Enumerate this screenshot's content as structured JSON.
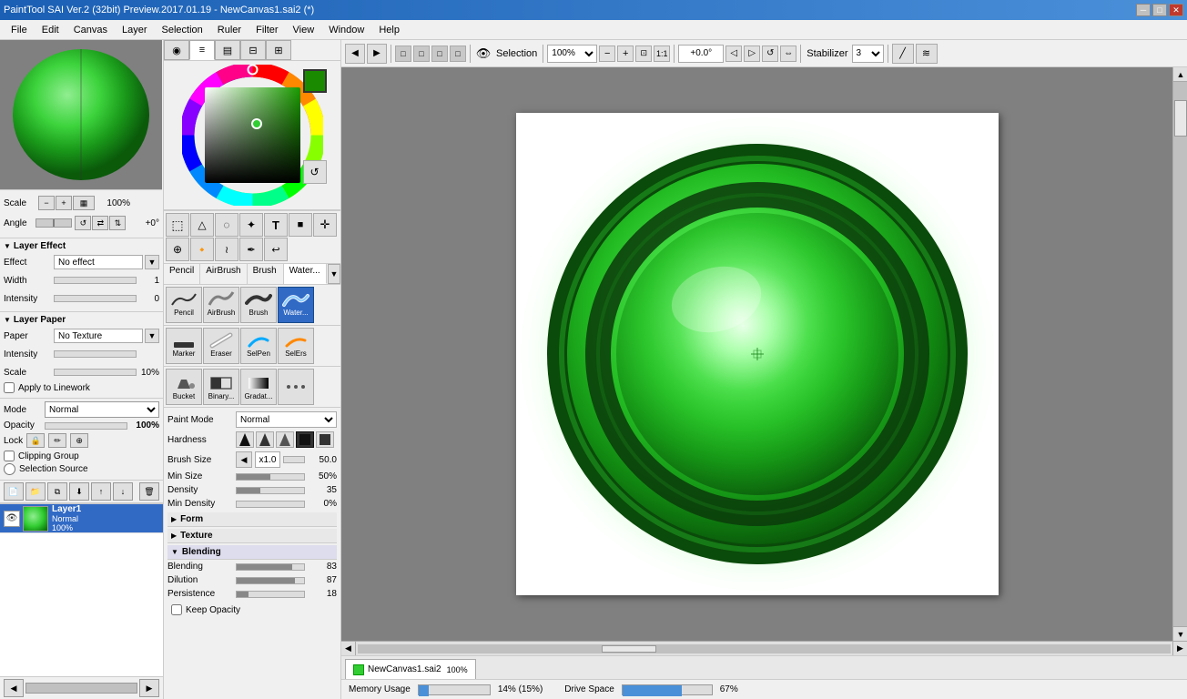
{
  "window": {
    "title": "PaintTool SAI Ver.2 (32bit) Preview.2017.01.19 - NewCanvas1.sai2 (*)",
    "controls": [
      "─",
      "□",
      "✕"
    ]
  },
  "menu": {
    "items": [
      "File",
      "Edit",
      "Canvas",
      "Layer",
      "Selection",
      "Ruler",
      "Filter",
      "View",
      "Window",
      "Help"
    ]
  },
  "toolbar": {
    "nav_btns": [
      "←",
      "→"
    ],
    "opacity_btns": [
      "□",
      "□",
      "□",
      "□"
    ],
    "selection_label": "Selection",
    "zoom_value": "100%",
    "zoom_minus": "−",
    "zoom_plus": "+",
    "zoom_fit": "⊡",
    "zoom_100": "1:1",
    "angle_value": "+0.0°",
    "angle_dec": "◁",
    "angle_inc": "▷",
    "angle_reset": "↺",
    "mirror": "⇔",
    "stabilizer_label": "Stabilizer",
    "stabilizer_value": "3",
    "tool1": "╱",
    "tool2": "≋"
  },
  "left_panel": {
    "scale_label": "Scale",
    "scale_value": "100%",
    "angle_label": "Angle",
    "angle_value": "+0°",
    "layer_effect_title": "Layer Effect",
    "effect_label": "Effect",
    "effect_value": "No effect",
    "width_label": "Width",
    "width_value": "",
    "intensity_label": "Intensity",
    "intensity_value": "0",
    "layer_paper_title": "Layer Paper",
    "paper_label": "Paper",
    "paper_value": "No Texture",
    "paper_intensity_label": "Intensity",
    "paper_scale_label": "Scale",
    "paper_scale_value": "10%",
    "apply_linework_label": "Apply to Linework",
    "mode_label": "Mode",
    "mode_value": "Normal",
    "opacity_label": "Opacity",
    "opacity_value": "100%",
    "lock_label": "Lock",
    "clipping_group_label": "Clipping Group",
    "selection_source_label": "Selection Source"
  },
  "layer_toolbar": {
    "buttons": [
      "new_layer",
      "new_group",
      "delete",
      "merge_down",
      "duplicate",
      "move_up",
      "move_down",
      "new_lset"
    ]
  },
  "layers": [
    {
      "name": "Layer1",
      "mode": "Normal",
      "opacity": "100%",
      "visible": true,
      "active": true
    }
  ],
  "color": {
    "mode_tabs": [
      {
        "id": "wheel",
        "icon": "◉"
      },
      {
        "id": "hsv",
        "icon": "≡"
      },
      {
        "id": "rgb",
        "icon": "⊞"
      },
      {
        "id": "cmyk",
        "icon": "⊟"
      },
      {
        "id": "other",
        "icon": "⊠"
      }
    ],
    "current": "#1a8a00"
  },
  "selection_tools": [
    {
      "id": "rect_sel",
      "icon": "⬚",
      "label": ""
    },
    {
      "id": "poly_sel",
      "icon": "△",
      "label": ""
    },
    {
      "id": "lasso_sel",
      "icon": "◌",
      "label": ""
    },
    {
      "id": "wand_sel",
      "icon": "✦",
      "label": ""
    },
    {
      "id": "text",
      "icon": "T",
      "label": ""
    },
    {
      "id": "fill_col",
      "icon": "■",
      "label": ""
    },
    {
      "id": "move",
      "icon": "✛",
      "label": ""
    },
    {
      "id": "zoom",
      "icon": "⊕",
      "label": ""
    },
    {
      "id": "eyedrop",
      "icon": "♦",
      "label": ""
    },
    {
      "id": "smear",
      "icon": "≀",
      "label": ""
    },
    {
      "id": "pen",
      "icon": "✒",
      "label": ""
    },
    {
      "id": "undo_sel",
      "icon": "↩",
      "label": ""
    }
  ],
  "brush_tabs": [
    {
      "label": "Pencil",
      "active": false
    },
    {
      "label": "AirBrush",
      "active": false
    },
    {
      "label": "Brush",
      "active": false
    },
    {
      "label": "Water...",
      "active": true
    }
  ],
  "brush_tools": [
    {
      "label": "Marker",
      "icon": "marker"
    },
    {
      "label": "Eraser",
      "icon": "eraser"
    },
    {
      "label": "SelPen",
      "icon": "selpen"
    },
    {
      "label": "SelErs",
      "icon": "selers"
    }
  ],
  "extra_tools": [
    {
      "label": "Bucket",
      "icon": "bucket"
    },
    {
      "label": "Binary...",
      "icon": "binary"
    },
    {
      "label": "Gradat...",
      "icon": "gradient"
    }
  ],
  "brush_params": {
    "paint_mode_label": "Paint Mode",
    "paint_mode_value": "Normal",
    "hardness_label": "Hardness",
    "brush_size_label": "Brush Size",
    "brush_size_mult": "x1.0",
    "brush_size_value": "50.0",
    "min_size_label": "Min Size",
    "min_size_value": "50%",
    "density_label": "Density",
    "density_value": "35",
    "min_density_label": "Min Density",
    "min_density_value": "0%",
    "form_label": "Form",
    "texture_label": "Texture",
    "blending_label": "Blending",
    "blending_sublabel": "Blending",
    "blending_value": "83",
    "dilution_label": "Dilution",
    "dilution_value": "87",
    "persistence_label": "Persistence",
    "persistence_value": "18",
    "keep_opacity_label": "Keep Opacity"
  },
  "canvas": {
    "tab_name": "NewCanvas1.sai2",
    "tab_zoom": "100%"
  },
  "statusbar": {
    "memory_label": "Memory Usage",
    "memory_value": "14% (15%)",
    "drive_label": "Drive Space",
    "drive_value": "67%"
  }
}
